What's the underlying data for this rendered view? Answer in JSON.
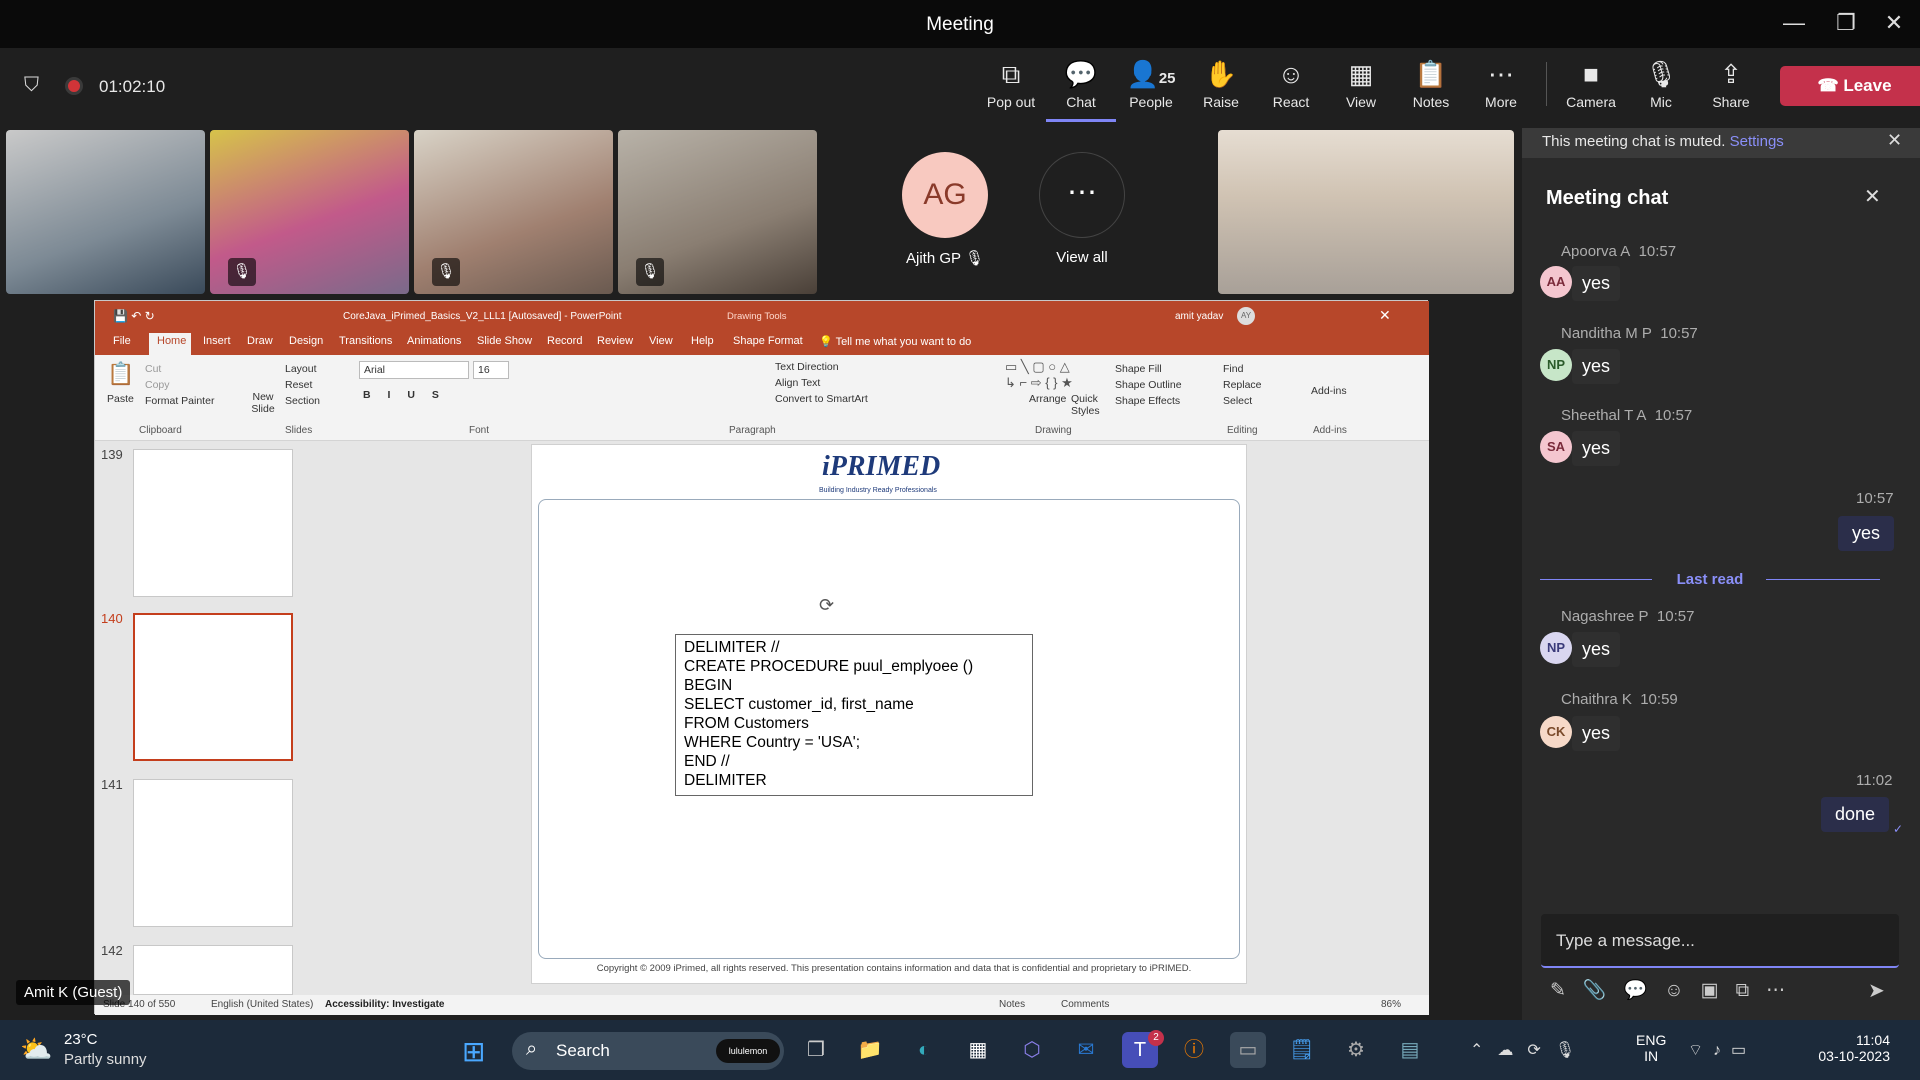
{
  "window": {
    "title": "Meeting"
  },
  "meeting": {
    "timer": "01:02:10",
    "people_count": "25"
  },
  "toolbar": {
    "popout": "Pop out",
    "chat": "Chat",
    "people": "People",
    "raise": "Raise",
    "react": "React",
    "view": "View",
    "notes": "Notes",
    "more": "More",
    "camera": "Camera",
    "mic": "Mic",
    "share": "Share",
    "leave": "Leave"
  },
  "participants": {
    "ag_initials": "AG",
    "ag_name": "Ajith GP",
    "view_all": "View all",
    "guest_label": "Amit K (Guest)"
  },
  "ppt": {
    "title": "CoreJava_iPrimed_Basics_V2_LLL1 [Autosaved]  -  PowerPoint",
    "drawing_tools": "Drawing Tools",
    "user": "amit yadav",
    "user_initials": "AY",
    "tabs": [
      "File",
      "Home",
      "Insert",
      "Draw",
      "Design",
      "Transitions",
      "Animations",
      "Slide Show",
      "Record",
      "Review",
      "View",
      "Help",
      "Shape Format"
    ],
    "tell_me": "Tell me what you want to do",
    "ribbon": {
      "paste": "Paste",
      "cut": "Cut",
      "copy": "Copy",
      "format_painter": "Format Painter",
      "clipboard": "Clipboard",
      "new_slide": "New Slide",
      "layout": "Layout",
      "reset": "Reset",
      "section": "Section",
      "slides": "Slides",
      "font_name": "Arial",
      "font_size": "16",
      "font": "Font",
      "text_direction": "Text Direction",
      "align_text": "Align Text",
      "convert_smartart": "Convert to SmartArt",
      "paragraph": "Paragraph",
      "arrange": "Arrange",
      "quick_styles": "Quick Styles",
      "shape_fill": "Shape Fill",
      "shape_outline": "Shape Outline",
      "shape_effects": "Shape Effects",
      "drawing": "Drawing",
      "find": "Find",
      "replace": "Replace",
      "select": "Select",
      "editing": "Editing",
      "addins": "Add-ins",
      "addins_group": "Add-ins"
    },
    "thumbs": [
      "139",
      "140",
      "141",
      "142"
    ],
    "slide": {
      "logo": "iPRIMED",
      "logo_tag": "Building Industry Ready Professionals",
      "code_lines": [
        "DELIMITER //",
        "CREATE PROCEDURE puul_emplyoee ()",
        "BEGIN",
        "SELECT customer_id, first_name",
        "FROM Customers",
        "WHERE Country = 'USA';",
        "END //",
        "DELIMITER"
      ],
      "footer": "Copyright © 2009 iPrimed, all rights reserved. This presentation contains information  and data  that is confidential and proprietary to iPRIMED."
    },
    "status": {
      "slide": "Slide 140 of 550",
      "lang": "English (United States)",
      "accessibility": "Accessibility: Investigate",
      "notes": "Notes",
      "comments": "Comments",
      "zoom": "86%"
    }
  },
  "chat": {
    "muted_notice": "This meeting chat is muted.",
    "settings_link": "Settings",
    "header": "Meeting chat",
    "last_read": "Last read",
    "input_placeholder": "Type a message...",
    "messages": [
      {
        "name": "Apoorva A",
        "time": "10:57",
        "initials": "AA",
        "text": "yes",
        "color": "#f4c6cf"
      },
      {
        "name": "Nanditha M P",
        "time": "10:57",
        "initials": "NP",
        "text": "yes",
        "color": "#c7e6c8"
      },
      {
        "name": "Sheethal T A",
        "time": "10:57",
        "initials": "SA",
        "text": "yes",
        "color": "#f4c6cf"
      },
      {
        "name": "Nagashree P",
        "time": "10:57",
        "initials": "NP",
        "text": "yes",
        "color": "#d9d6f0"
      },
      {
        "name": "Chaithra K",
        "time": "10:59",
        "initials": "CK",
        "text": "yes",
        "color": "#f6d9c8"
      }
    ],
    "my_messages": [
      {
        "time": "10:57",
        "text": "yes"
      },
      {
        "time": "11:02",
        "text": "done"
      }
    ]
  },
  "taskbar": {
    "weather_temp": "23°C",
    "weather_desc": "Partly sunny",
    "search": "Search",
    "search_badge": "lululemon",
    "teams_badge": "2",
    "lang1": "ENG",
    "lang2": "IN",
    "time": "11:04",
    "date": "03-10-2023"
  },
  "colors": {
    "leave": "#c4314b",
    "accent": "#7f85f5",
    "ppt": "#b7472a"
  }
}
